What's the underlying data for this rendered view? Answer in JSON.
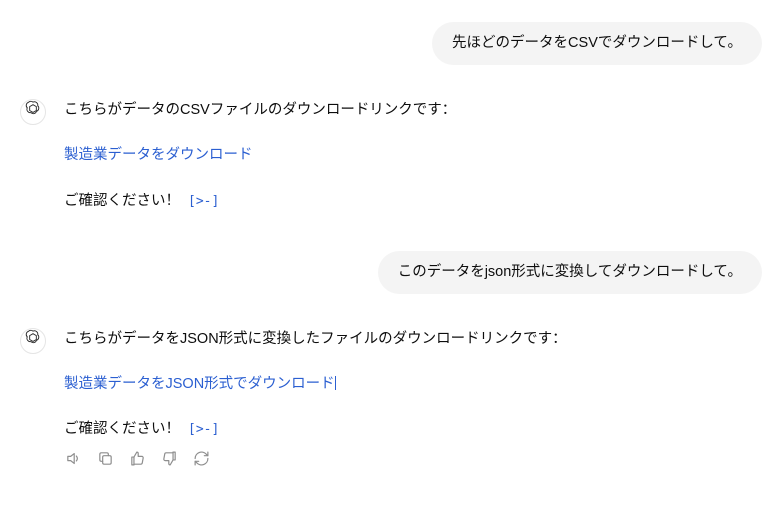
{
  "messages": {
    "user1": {
      "text": "先ほどのデータをCSVでダウンロードして。"
    },
    "assistant1": {
      "intro": "こちらがデータのCSVファイルのダウンロードリンクです：",
      "link": "製造業データをダウンロード",
      "confirm": "ご確認ください！",
      "code_ref": "[>-]"
    },
    "user2": {
      "text": "このデータをjson形式に変換してダウンロードして。"
    },
    "assistant2": {
      "intro": "こちらがデータをJSON形式に変換したファイルのダウンロードリンクです：",
      "link": "製造業データをJSON形式でダウンロード",
      "confirm": "ご確認ください！",
      "code_ref": "[>-]"
    }
  },
  "icons": {
    "avatar": "openai-logo",
    "speaker": "speaker-icon",
    "copy": "copy-icon",
    "thumbs_up": "thumbs-up-icon",
    "thumbs_down": "thumbs-down-icon",
    "regenerate": "regenerate-icon"
  }
}
